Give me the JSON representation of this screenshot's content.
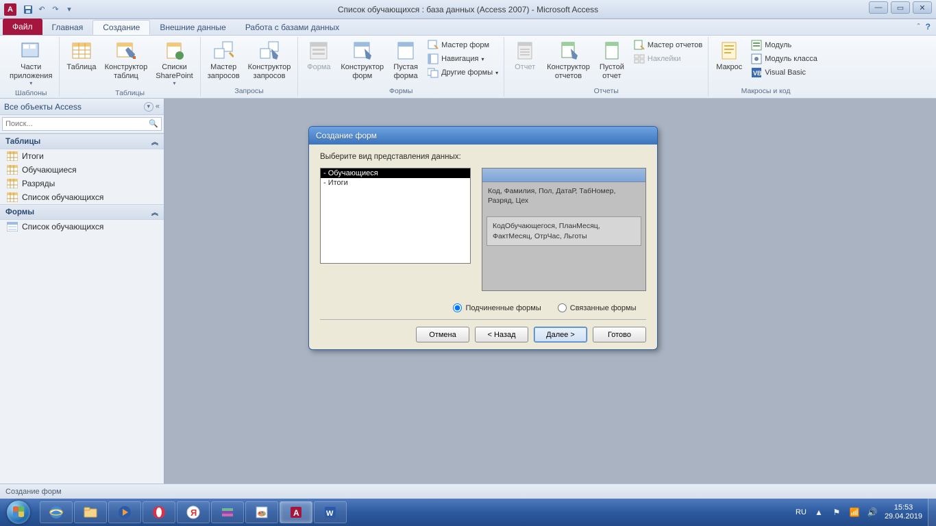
{
  "title": "Список обучающихся : база данных (Access 2007)  -  Microsoft Access",
  "tabs": {
    "file": "Файл",
    "home": "Главная",
    "create": "Создание",
    "external": "Внешние данные",
    "dbtools": "Работа с базами данных"
  },
  "ribbon": {
    "g_templates": "Шаблоны",
    "app_parts": "Части\nприложения",
    "g_tables": "Таблицы",
    "table": "Таблица",
    "table_design": "Конструктор\nтаблиц",
    "sharepoint": "Списки\nSharePoint",
    "g_queries": "Запросы",
    "query_wiz": "Мастер\nзапросов",
    "query_design": "Конструктор\nзапросов",
    "g_forms": "Формы",
    "form": "Форма",
    "form_design": "Конструктор\nформ",
    "blank_form": "Пустая\nформа",
    "form_wiz": "Мастер форм",
    "nav": "Навигация",
    "other_forms": "Другие формы",
    "g_reports": "Отчеты",
    "report": "Отчет",
    "report_design": "Конструктор\nотчетов",
    "blank_report": "Пустой\nотчет",
    "report_wiz": "Мастер отчетов",
    "labels": "Наклейки",
    "g_macros": "Макросы и код",
    "macro": "Макрос",
    "module": "Модуль",
    "class_module": "Модуль класса",
    "vb": "Visual Basic"
  },
  "nav": {
    "header": "Все объекты Access",
    "search_ph": "Поиск...",
    "grp_tables": "Таблицы",
    "t1": "Итоги",
    "t2": "Обучающиеся",
    "t3": "Разряды",
    "t4": "Список обучающихся",
    "grp_forms": "Формы",
    "f1": "Список обучающихся"
  },
  "dialog": {
    "title": "Создание форм",
    "prompt": "Выберите вид представления данных:",
    "list_item1": "- Обучающиеся",
    "list_item2": "- Итоги",
    "preview1": "Код, Фамилия, Пол, ДатаР, ТабНомер, Разряд, Цех",
    "preview2": "КодОбучающегося, ПланМесяц, ФактМесяц, ОтрЧас, Льготы",
    "radio1": "Подчиненные формы",
    "radio2": "Связанные формы",
    "cancel": "Отмена",
    "back": "< Назад",
    "next": "Далее >",
    "finish": "Готово"
  },
  "status": "Создание форм",
  "tray": {
    "lang": "RU",
    "time": "15:53",
    "date": "29.04.2019"
  }
}
